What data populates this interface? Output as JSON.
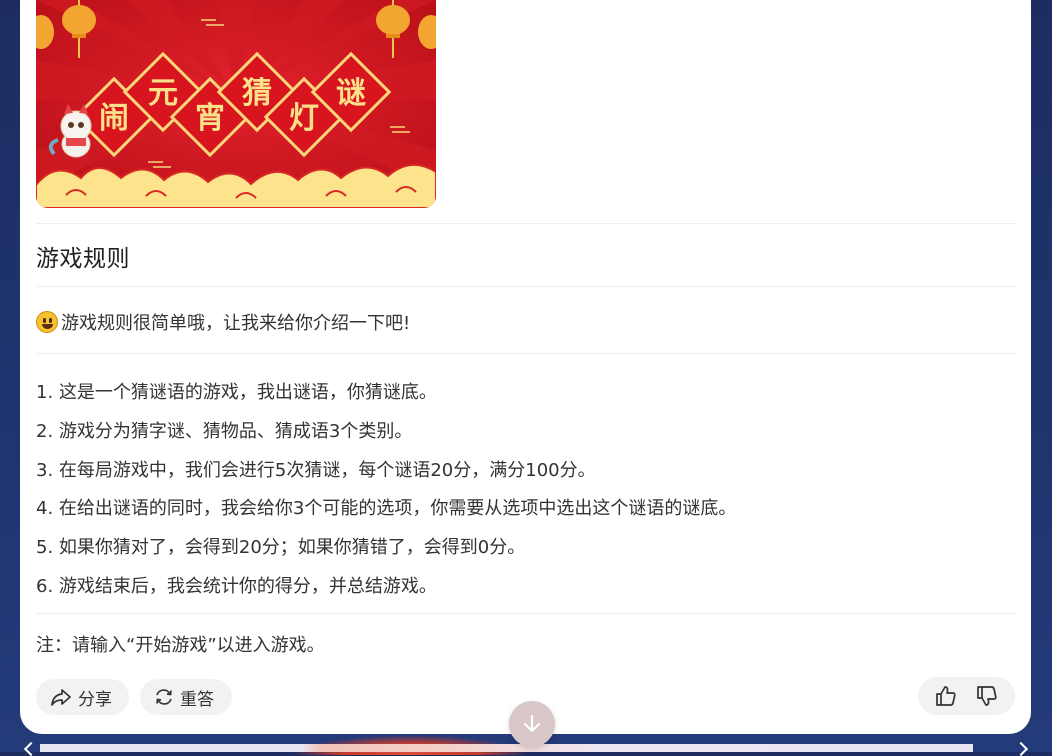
{
  "banner": {
    "title_chars": [
      "闹",
      "元",
      "宵",
      "猜",
      "灯",
      "谜"
    ],
    "colors": {
      "red": "#c9131d",
      "gold": "#f6d77a",
      "cloud": "#fde38c"
    }
  },
  "section": {
    "title": "游戏规则"
  },
  "intro": {
    "emoji": "grinning-face-icon",
    "text": "游戏规则很简单哦，让我来给你介绍一下吧!"
  },
  "rules": [
    "1. 这是一个猜谜语的游戏，我出谜语，你猜谜底。",
    "2. 游戏分为猜字谜、猜物品、猜成语3个类别。",
    "3. 在每局游戏中，我们会进行5次猜谜，每个谜语20分，满分100分。",
    "4. 在给出谜语的同时，我会给你3个可能的选项，你需要从选项中选出这个谜语的谜底。",
    "5. 如果你猜对了，会得到20分；如果你猜错了，会得到0分。",
    "6. 游戏结束后，我会统计你的得分，并总结游戏。"
  ],
  "note": "注：请输入“开始游戏”以进入游戏。",
  "actions": {
    "share_label": "分享",
    "regenerate_label": "重答"
  },
  "feedback": {
    "like": "thumbs-up-icon",
    "dislike": "thumbs-down-icon"
  },
  "scroll": {
    "icon": "arrow-down-icon"
  }
}
